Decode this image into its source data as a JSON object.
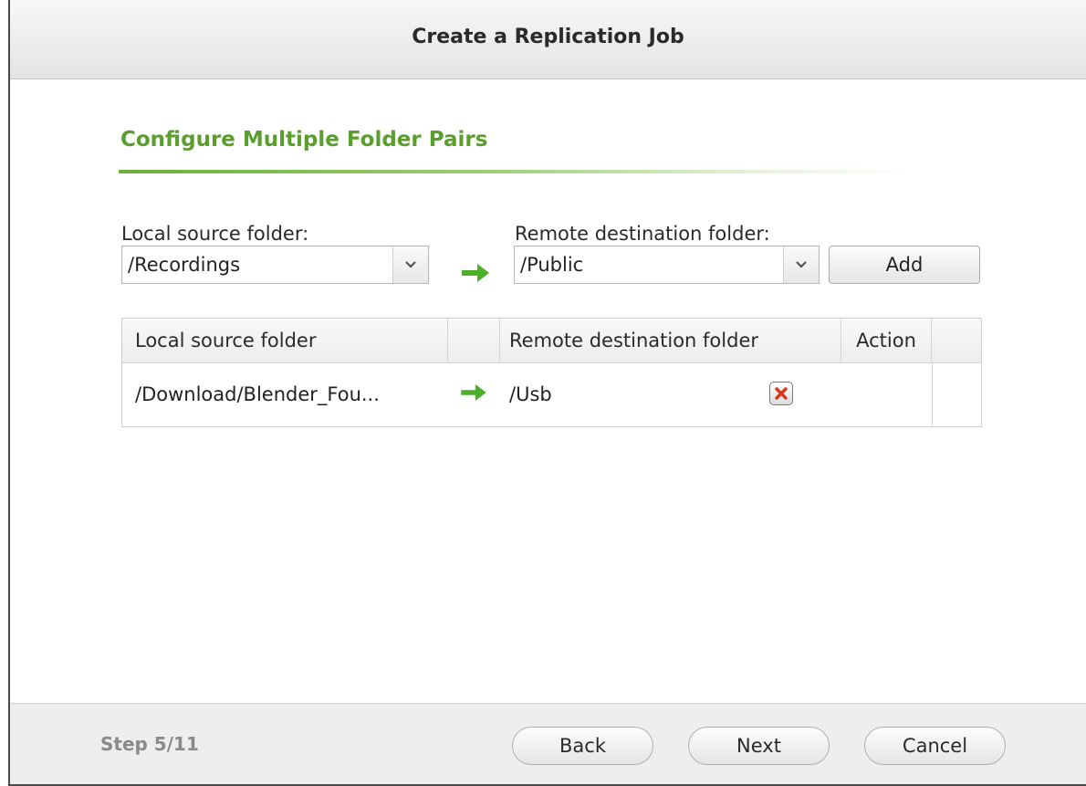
{
  "dialog": {
    "title": "Create a Replication Job"
  },
  "section": {
    "title": "Configure Multiple Folder Pairs"
  },
  "form": {
    "local_label": "Local source folder:",
    "local_value": "/Recordings",
    "remote_label": "Remote destination folder:",
    "remote_value": "/Public",
    "add_label": "Add"
  },
  "table": {
    "headers": {
      "local": "Local source folder",
      "remote": "Remote destination folder",
      "action": "Action"
    },
    "rows": [
      {
        "local": "/Download/Blender_Fou...",
        "remote": "/Usb"
      }
    ]
  },
  "footer": {
    "step": "Step 5/11",
    "back_label": "Back",
    "next_label": "Next",
    "cancel_label": "Cancel"
  },
  "colors": {
    "accent_green": "#5a9e2d",
    "arrow_green": "#4caf2a",
    "delete_red": "#d9341c"
  },
  "icons": {
    "pair_arrow": "right-arrow-icon",
    "dropdown": "chevron-down-icon",
    "delete": "close-icon"
  }
}
